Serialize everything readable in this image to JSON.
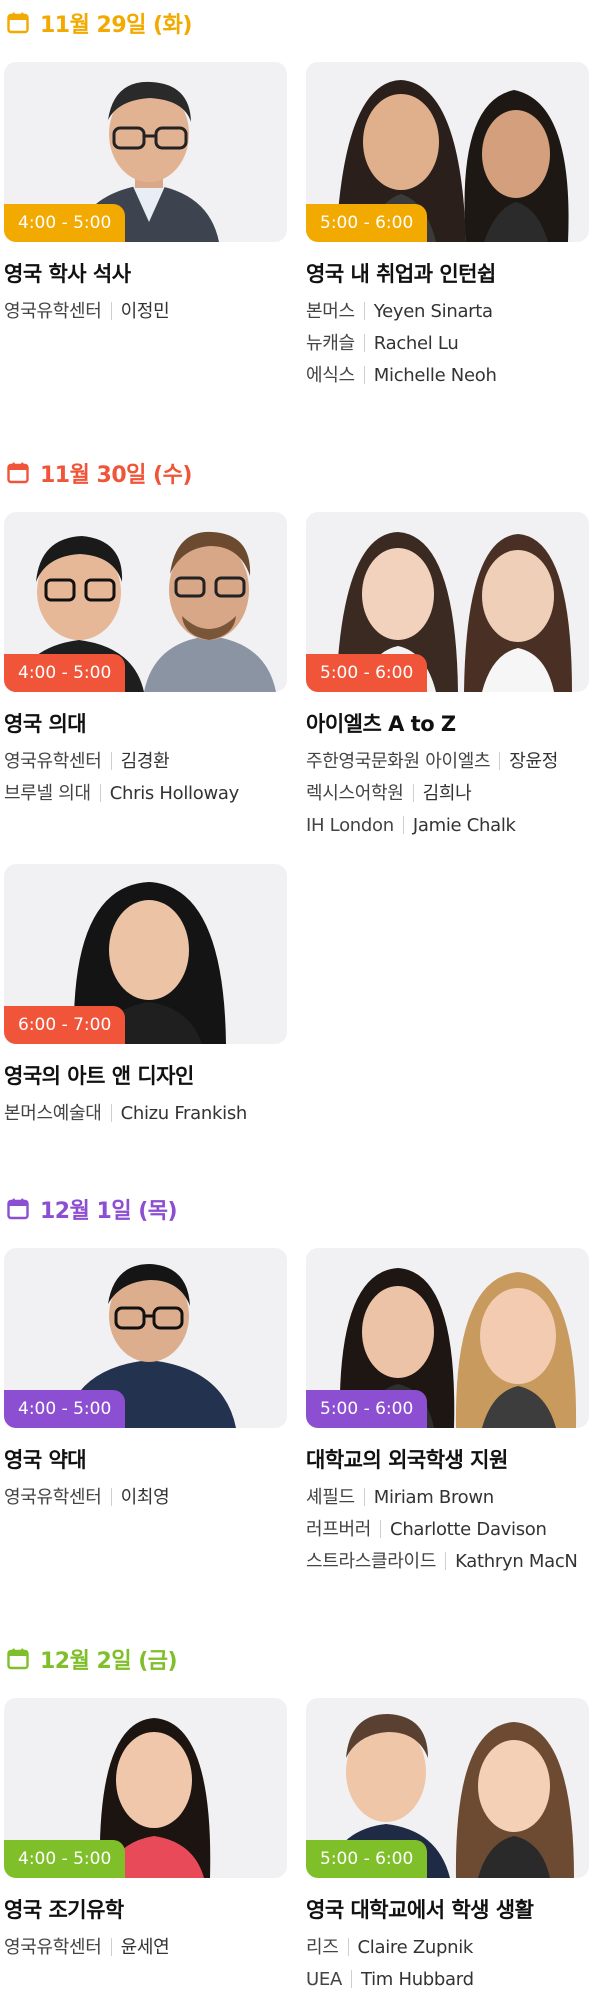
{
  "colors": {
    "day1": "#f2a900",
    "day2": "#f0553a",
    "day3": "#8c4fd1",
    "day4": "#7fbf2a"
  },
  "days": [
    {
      "date": "11월 29일 (화)",
      "icon": "calendar-icon",
      "sessions": [
        {
          "time": "4:00 - 5:00",
          "title": "영국 학사 석사",
          "speakers": [
            {
              "org": "영국유학센터",
              "name": "이정민"
            }
          ]
        },
        {
          "time": "5:00 - 6:00",
          "title": "영국 내 취업과 인턴쉽",
          "speakers": [
            {
              "org": "본머스",
              "name": "Yeyen Sinarta"
            },
            {
              "org": "뉴캐슬",
              "name": "Rachel Lu"
            },
            {
              "org": "에식스",
              "name": "Michelle Neoh"
            }
          ]
        }
      ]
    },
    {
      "date": "11월 30일 (수)",
      "icon": "calendar-icon",
      "sessions": [
        {
          "time": "4:00 - 5:00",
          "title": "영국 의대",
          "speakers": [
            {
              "org": "영국유학센터",
              "name": "김경환"
            },
            {
              "org": "브루넬 의대",
              "name": "Chris Holloway"
            }
          ]
        },
        {
          "time": "5:00 - 6:00",
          "title": "아이엘츠 A to Z",
          "speakers": [
            {
              "org": "주한영국문화원 아이엘츠",
              "name": "장윤정"
            },
            {
              "org": "렉시스어학원",
              "name": "김희나"
            },
            {
              "org": "IH London",
              "name": "Jamie Chalk"
            }
          ]
        },
        {
          "time": "6:00 - 7:00",
          "title": "영국의 아트 앤 디자인",
          "speakers": [
            {
              "org": "본머스예술대",
              "name": "Chizu Frankish"
            }
          ]
        }
      ]
    },
    {
      "date": "12월 1일 (목)",
      "icon": "calendar-icon",
      "sessions": [
        {
          "time": "4:00 - 5:00",
          "title": "영국 약대",
          "speakers": [
            {
              "org": "영국유학센터",
              "name": "이최영"
            }
          ]
        },
        {
          "time": "5:00 - 6:00",
          "title": "대학교의 외국학생 지원",
          "speakers": [
            {
              "org": "셰필드",
              "name": "Miriam Brown"
            },
            {
              "org": "러프버러",
              "name": "Charlotte Davison"
            },
            {
              "org": "스트라스클라이드",
              "name": "Kathryn MacN"
            }
          ]
        }
      ]
    },
    {
      "date": "12월 2일 (금)",
      "icon": "calendar-icon",
      "sessions": [
        {
          "time": "4:00 - 5:00",
          "title": "영국 조기유학",
          "speakers": [
            {
              "org": "영국유학센터",
              "name": "윤세연"
            }
          ]
        },
        {
          "time": "5:00 - 6:00",
          "title": "영국 대학교에서 학생 생활",
          "speakers": [
            {
              "org": "리즈",
              "name": "Claire Zupnik"
            },
            {
              "org": "UEA",
              "name": "Tim Hubbard"
            }
          ]
        }
      ]
    }
  ]
}
